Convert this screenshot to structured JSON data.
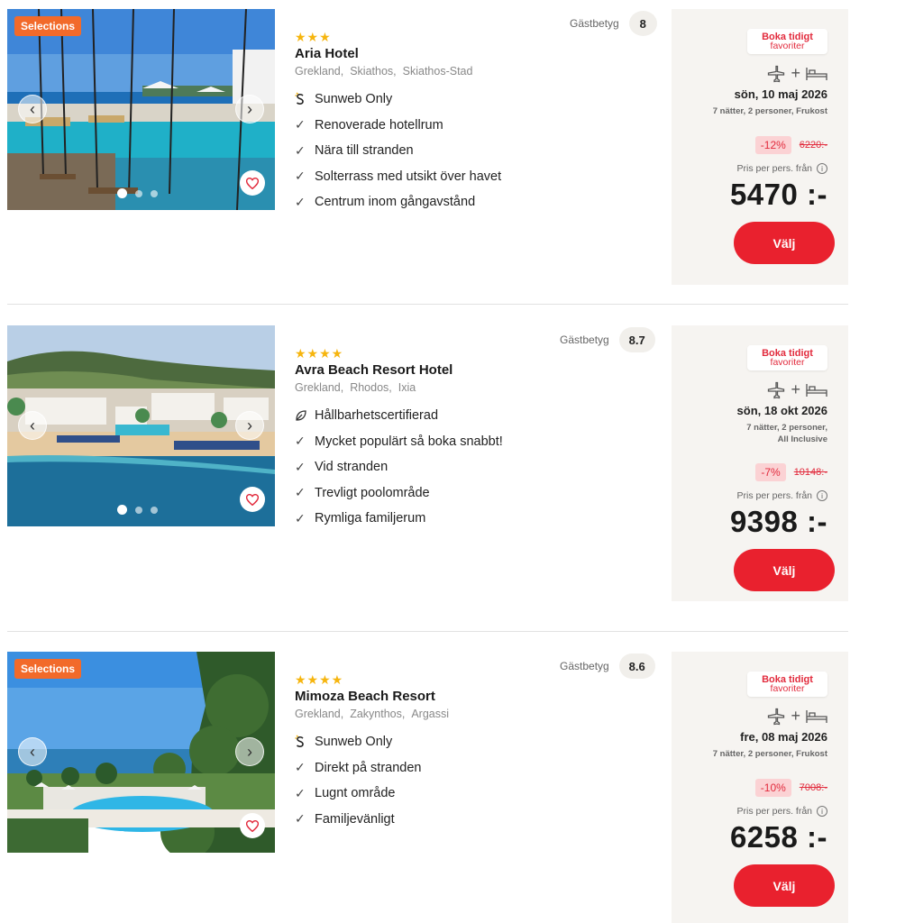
{
  "labels": {
    "rating": "Gästbetyg",
    "pris_per_pers": "Pris per pers. från",
    "valj": "Välj",
    "selections": "Selections",
    "boka_tidigt_1": "Boka tidigt",
    "boka_tidigt_2": "favoriter"
  },
  "colors": {
    "accent": "#e9212e",
    "selections_badge": "#f26a2a",
    "stars": "#f6b50e",
    "panel_bg": "#f6f4f1",
    "discount_bg": "#fbd2d4"
  },
  "hotels": [
    {
      "name": "Aria Hotel",
      "stars": "★★★",
      "location": [
        "Grekland,",
        "Skiathos,",
        "Skiathos-Stad"
      ],
      "features": [
        {
          "icon": "sunweb-icon",
          "text": "Sunweb Only"
        },
        {
          "icon": "check-icon",
          "text": "Renoverade hotellrum"
        },
        {
          "icon": "check-icon",
          "text": "Nära till stranden"
        },
        {
          "icon": "check-icon",
          "text": "Solterrass med utsikt över havet"
        },
        {
          "icon": "check-icon",
          "text": "Centrum inom gångavstånd"
        }
      ],
      "rating": "8",
      "date": "sön, 10 maj 2026",
      "nights_line1": "7 nätter, 2 personer, Frukost",
      "nights_line2": "",
      "discount": "-12%",
      "old_price": "6220:-",
      "price": "5470 :-"
    },
    {
      "name": "Avra Beach Resort Hotel",
      "stars": "★★★★",
      "location": [
        "Grekland,",
        "Rhodos,",
        "Ixia"
      ],
      "features": [
        {
          "icon": "leaf-icon",
          "text": "Hållbarhetscertifierad"
        },
        {
          "icon": "check-icon",
          "text": "Mycket populärt så boka snabbt!"
        },
        {
          "icon": "check-icon",
          "text": "Vid stranden"
        },
        {
          "icon": "check-icon",
          "text": "Trevligt poolområde"
        },
        {
          "icon": "check-icon",
          "text": "Rymliga familjerum"
        }
      ],
      "rating": "8.7",
      "date": "sön, 18 okt 2026",
      "nights_line1": "7 nätter, 2 personer,",
      "nights_line2": "All Inclusive",
      "discount": "-7%",
      "old_price": "10148:-",
      "price": "9398 :-"
    },
    {
      "name": "Mimoza Beach Resort",
      "stars": "★★★★",
      "location": [
        "Grekland,",
        "Zakynthos,",
        "Argassi"
      ],
      "features": [
        {
          "icon": "sunweb-icon",
          "text": "Sunweb Only"
        },
        {
          "icon": "check-icon",
          "text": "Direkt på stranden"
        },
        {
          "icon": "check-icon",
          "text": "Lugnt område"
        },
        {
          "icon": "check-icon",
          "text": "Familjevänligt"
        }
      ],
      "rating": "8.6",
      "date": "fre, 08 maj 2026",
      "nights_line1": "7 nätter, 2 personer, Frukost",
      "nights_line2": "",
      "discount": "-10%",
      "old_price": "7008:-",
      "price": "6258 :-"
    }
  ]
}
